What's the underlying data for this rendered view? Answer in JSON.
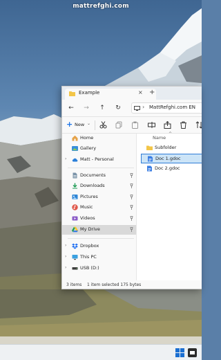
{
  "watermark": "mattrefghi.com",
  "window": {
    "tab_title": "Example",
    "tab_close": "×",
    "tab_add": "+",
    "nav": {
      "back": "←",
      "forward": "→",
      "up": "↑",
      "refresh": "↻"
    },
    "address": {
      "chevron": "›",
      "text": "MattRefghi.com EN"
    },
    "toolbar": {
      "new_label": "New",
      "new_plus": "+",
      "new_chevron": "⌄"
    },
    "nav_pane": [
      {
        "label": "Home",
        "icon": "home-icon"
      },
      {
        "label": "Gallery",
        "icon": "gallery-icon"
      },
      {
        "label": "Matt - Personal",
        "icon": "cloud-icon",
        "expander": "›"
      },
      {
        "label": "Documents",
        "icon": "documents-icon",
        "pinned": true
      },
      {
        "label": "Downloads",
        "icon": "downloads-icon",
        "pinned": true
      },
      {
        "label": "Pictures",
        "icon": "pictures-icon",
        "pinned": true
      },
      {
        "label": "Music",
        "icon": "music-icon",
        "pinned": true
      },
      {
        "label": "Videos",
        "icon": "videos-icon",
        "pinned": true
      },
      {
        "label": "My Drive",
        "icon": "google-drive-icon",
        "pinned": true,
        "selected": true
      },
      {
        "label": "Dropbox",
        "icon": "dropbox-icon",
        "expander": "›"
      },
      {
        "label": "This PC",
        "icon": "this-pc-icon",
        "expander": "›"
      },
      {
        "label": "USB (D:)",
        "icon": "usb-drive-icon",
        "expander": "›"
      }
    ],
    "column_header": "Name",
    "column_caret": "^",
    "files": [
      {
        "label": "Subfolder",
        "icon": "folder-icon",
        "selected": false
      },
      {
        "label": "Doc 1.gdoc",
        "icon": "gdoc-icon",
        "selected": true
      },
      {
        "label": "Doc 2.gdoc",
        "icon": "gdoc-icon",
        "selected": false
      }
    ],
    "status": {
      "items": "3 items",
      "selection": "1 item selected  175 bytes"
    }
  },
  "colors": {
    "accent": "#2d7cd6",
    "selection_bg": "#cce4f7",
    "folder": "#f3c649"
  }
}
